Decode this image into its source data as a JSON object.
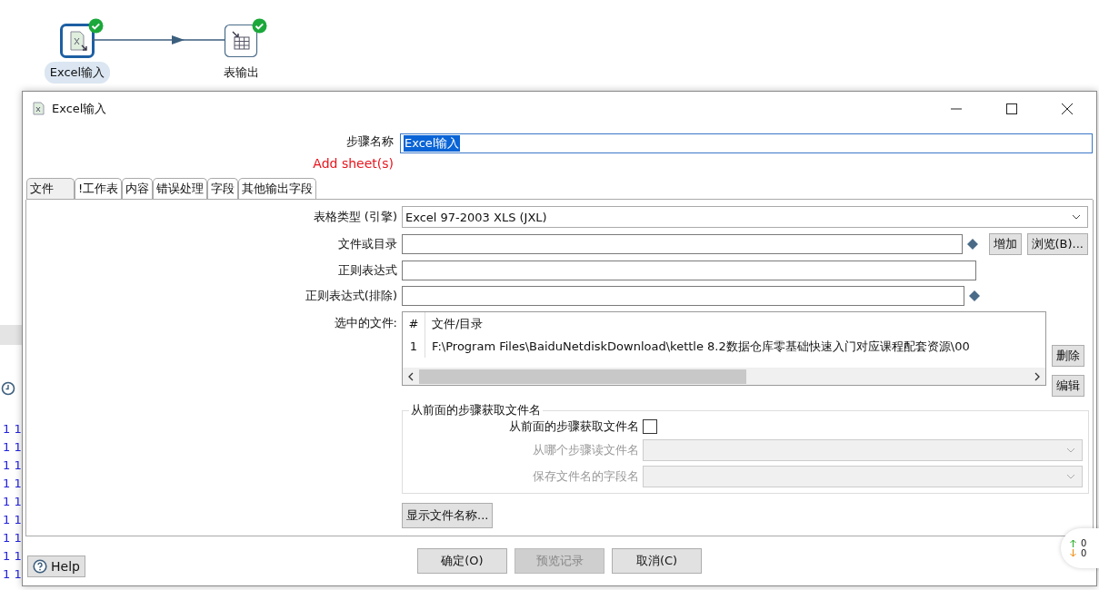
{
  "canvas": {
    "steps": [
      {
        "label": "Excel输入",
        "kind": "excel",
        "selected": true,
        "ok": true
      },
      {
        "label": "表输出",
        "kind": "table",
        "selected": false,
        "ok": true
      }
    ],
    "log_rows": [
      "1 1",
      "1 1",
      "1 1",
      "1 1",
      "1 1",
      "1 1",
      "1 1",
      "1 1",
      "1 1"
    ]
  },
  "dialog": {
    "title": "Excel输入",
    "step_name": {
      "label": "步骤名称",
      "value": "Excel输入"
    },
    "add_sheets": "Add sheet(s)",
    "tabs": [
      {
        "label": "文件",
        "selected": true
      },
      {
        "label": "!工作表",
        "selected": false
      },
      {
        "label": "内容",
        "selected": false
      },
      {
        "label": "错误处理",
        "selected": false
      },
      {
        "label": "字段",
        "selected": false
      },
      {
        "label": "其他输出字段",
        "selected": false
      }
    ],
    "engine": {
      "label": "表格类型 (引擎)",
      "value": "Excel 97-2003 XLS (JXL)"
    },
    "file_or_dir": {
      "label": "文件或目录",
      "buttons": [
        "增加",
        "浏览(B)..."
      ]
    },
    "regex": {
      "label": "正则表达式"
    },
    "regex_exclude": {
      "label": "正则表达式(排除)"
    },
    "selected_files": {
      "label": "选中的文件:",
      "columns": [
        "#",
        "文件/目录"
      ],
      "rows": [
        [
          "1",
          "F:\\Program Files\\BaiduNetdiskDownload\\kettle 8.2数据仓库零基础快速入门对应课程配套资源\\00"
        ]
      ],
      "buttons": [
        "删除",
        "编辑"
      ]
    },
    "from_previous": {
      "legend": "从前面的步骤获取文件名",
      "checkbox": {
        "label": "从前面的步骤获取文件名",
        "checked": false
      },
      "fields": [
        {
          "label": "从哪个步骤读文件名",
          "disabled": true
        },
        {
          "label": "保存文件名的字段名",
          "disabled": true
        }
      ]
    },
    "show_filenames": "显示文件名称...",
    "help": "Help",
    "buttons": [
      {
        "label": "确定(O)",
        "disabled": false
      },
      {
        "label": "预览记录",
        "disabled": true
      },
      {
        "label": "取消(C)",
        "disabled": false
      }
    ]
  },
  "net_widget": {
    "up": "0",
    "down": "0"
  }
}
